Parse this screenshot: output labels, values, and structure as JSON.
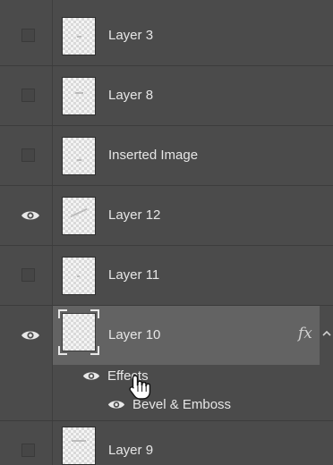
{
  "layers": [
    {
      "name": "Layer 3",
      "visible": false,
      "selected": false,
      "has_fx": false
    },
    {
      "name": "Layer 8",
      "visible": false,
      "selected": false,
      "has_fx": false
    },
    {
      "name": "Inserted Image",
      "visible": false,
      "selected": false,
      "has_fx": false
    },
    {
      "name": "Layer 12",
      "visible": true,
      "selected": false,
      "has_fx": false
    },
    {
      "name": "Layer 11",
      "visible": false,
      "selected": false,
      "has_fx": false
    },
    {
      "name": "Layer 10",
      "visible": true,
      "selected": true,
      "has_fx": true,
      "fx_label": "fx"
    },
    {
      "name": "Layer 9",
      "visible": false,
      "selected": false,
      "has_fx": false
    }
  ],
  "effects": {
    "group_label": "Effects",
    "items": [
      "Bevel & Emboss"
    ]
  },
  "icons": {
    "visibility": "eye-icon",
    "collapse": "chevron-up-icon",
    "cursor": "hand-pointer-icon"
  },
  "colors": {
    "panel_bg": "#4b4b4b",
    "selected_bg": "#636363",
    "text": "#e6e6e6"
  }
}
